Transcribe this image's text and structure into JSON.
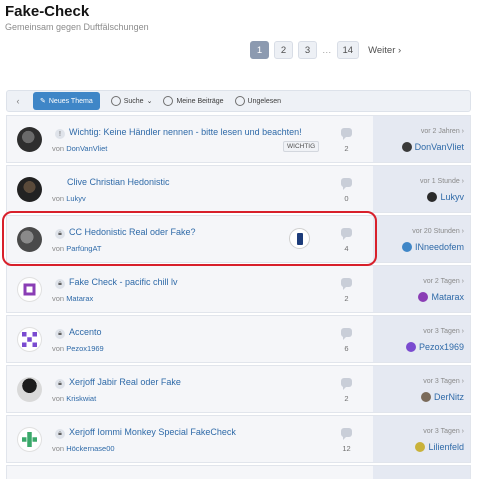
{
  "page": {
    "title": "Fake-Check",
    "subtitle": "Gemeinsam gegen Duftfälschungen"
  },
  "pagination": {
    "pages": [
      "1",
      "2",
      "3"
    ],
    "ellipsis": "…",
    "last": "14",
    "next": "Weiter ›",
    "current": "1"
  },
  "toolbar": {
    "back": "‹",
    "new_thread": "Neues Thema",
    "search": "Suche",
    "my_posts": "Meine Beiträge",
    "unread": "Ungelesen"
  },
  "threads": [
    {
      "icon": "exclamation-icon",
      "title": "Wichtig: Keine Händler nennen - bitte lesen und beachten!",
      "by": "von",
      "author": "DonVanVliet",
      "tag": "WICHTIG",
      "replies": "2",
      "time": "vor 2 Jahren ›",
      "last_user": "DonVanVliet",
      "last_color": "#3a3a3a"
    },
    {
      "icon": "",
      "title": "Clive Christian Hedonistic",
      "by": "von",
      "author": "Lukyv",
      "replies": "0",
      "time": "vor 1 Stunde ›",
      "last_user": "Lukyv",
      "last_color": "#2a2a2a"
    },
    {
      "icon": "lock-icon",
      "title": "CC Hedonistic Real oder Fake?",
      "by": "von",
      "author": "ParfüngAT",
      "replies": "4",
      "time": "vor 20 Stunden ›",
      "last_user": "INneedofem",
      "last_color": "#3f86c7"
    },
    {
      "icon": "lock-icon",
      "title": "Fake Check - pacific chill lv",
      "by": "von",
      "author": "Matarax",
      "replies": "2",
      "time": "vor 2 Tagen ›",
      "last_user": "Matarax",
      "last_color": "#8a3db5"
    },
    {
      "icon": "lock-icon",
      "title": "Accento",
      "by": "von",
      "author": "Pezox1969",
      "replies": "6",
      "time": "vor 3 Tagen ›",
      "last_user": "Pezox1969",
      "last_color": "#7a4bd0"
    },
    {
      "icon": "lock-icon",
      "title": "Xerjoff Jabir Real oder Fake",
      "by": "von",
      "author": "Kriskwiat",
      "replies": "2",
      "time": "vor 3 Tagen ›",
      "last_user": "DerNitz",
      "last_color": "#7a6a5a"
    },
    {
      "icon": "lock-icon",
      "title": "Xerjoff Iommi Monkey Special FakeCheck",
      "by": "von",
      "author": "Höckernase00",
      "replies": "12",
      "time": "vor 3 Tagen ›",
      "last_user": "Lilienfeld",
      "last_color": "#c9b23a"
    }
  ],
  "colors": {
    "accent": "#3f86c7",
    "link": "#2f6aa8",
    "highlight": "#d8202b",
    "active_page": "#8c9ab0"
  }
}
